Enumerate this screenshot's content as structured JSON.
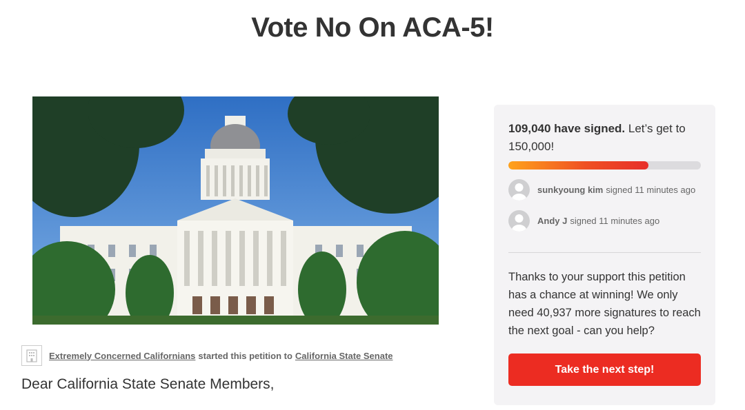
{
  "page": {
    "title": "Vote No On ACA-5!"
  },
  "petition": {
    "image_alt_icon": "capitol-building-photo",
    "starter_name": "Extremely Concerned Californians",
    "started_text": "started this petition to",
    "target": "California State Senate",
    "greeting": "Dear California State Senate Members,"
  },
  "panel": {
    "signed_count": "109,040 have signed.",
    "goal_text": "Let’s get to 150,000!",
    "progress_fraction": 0.727,
    "recent_signers": [
      {
        "name": "sunkyoung kim",
        "action": "signed 11 minutes ago"
      },
      {
        "name": "Andy J",
        "action": "signed 11 minutes ago"
      }
    ],
    "support_text": "Thanks to your support this petition has a chance at winning! We only need 40,937 more signatures to reach the next goal - can you help?",
    "cta_label": "Take the next step!"
  },
  "colors": {
    "cta": "#ec2c22",
    "panel_bg": "#f4f3f5",
    "progress_start": "#ffa21c",
    "progress_end": "#e72f2b"
  }
}
